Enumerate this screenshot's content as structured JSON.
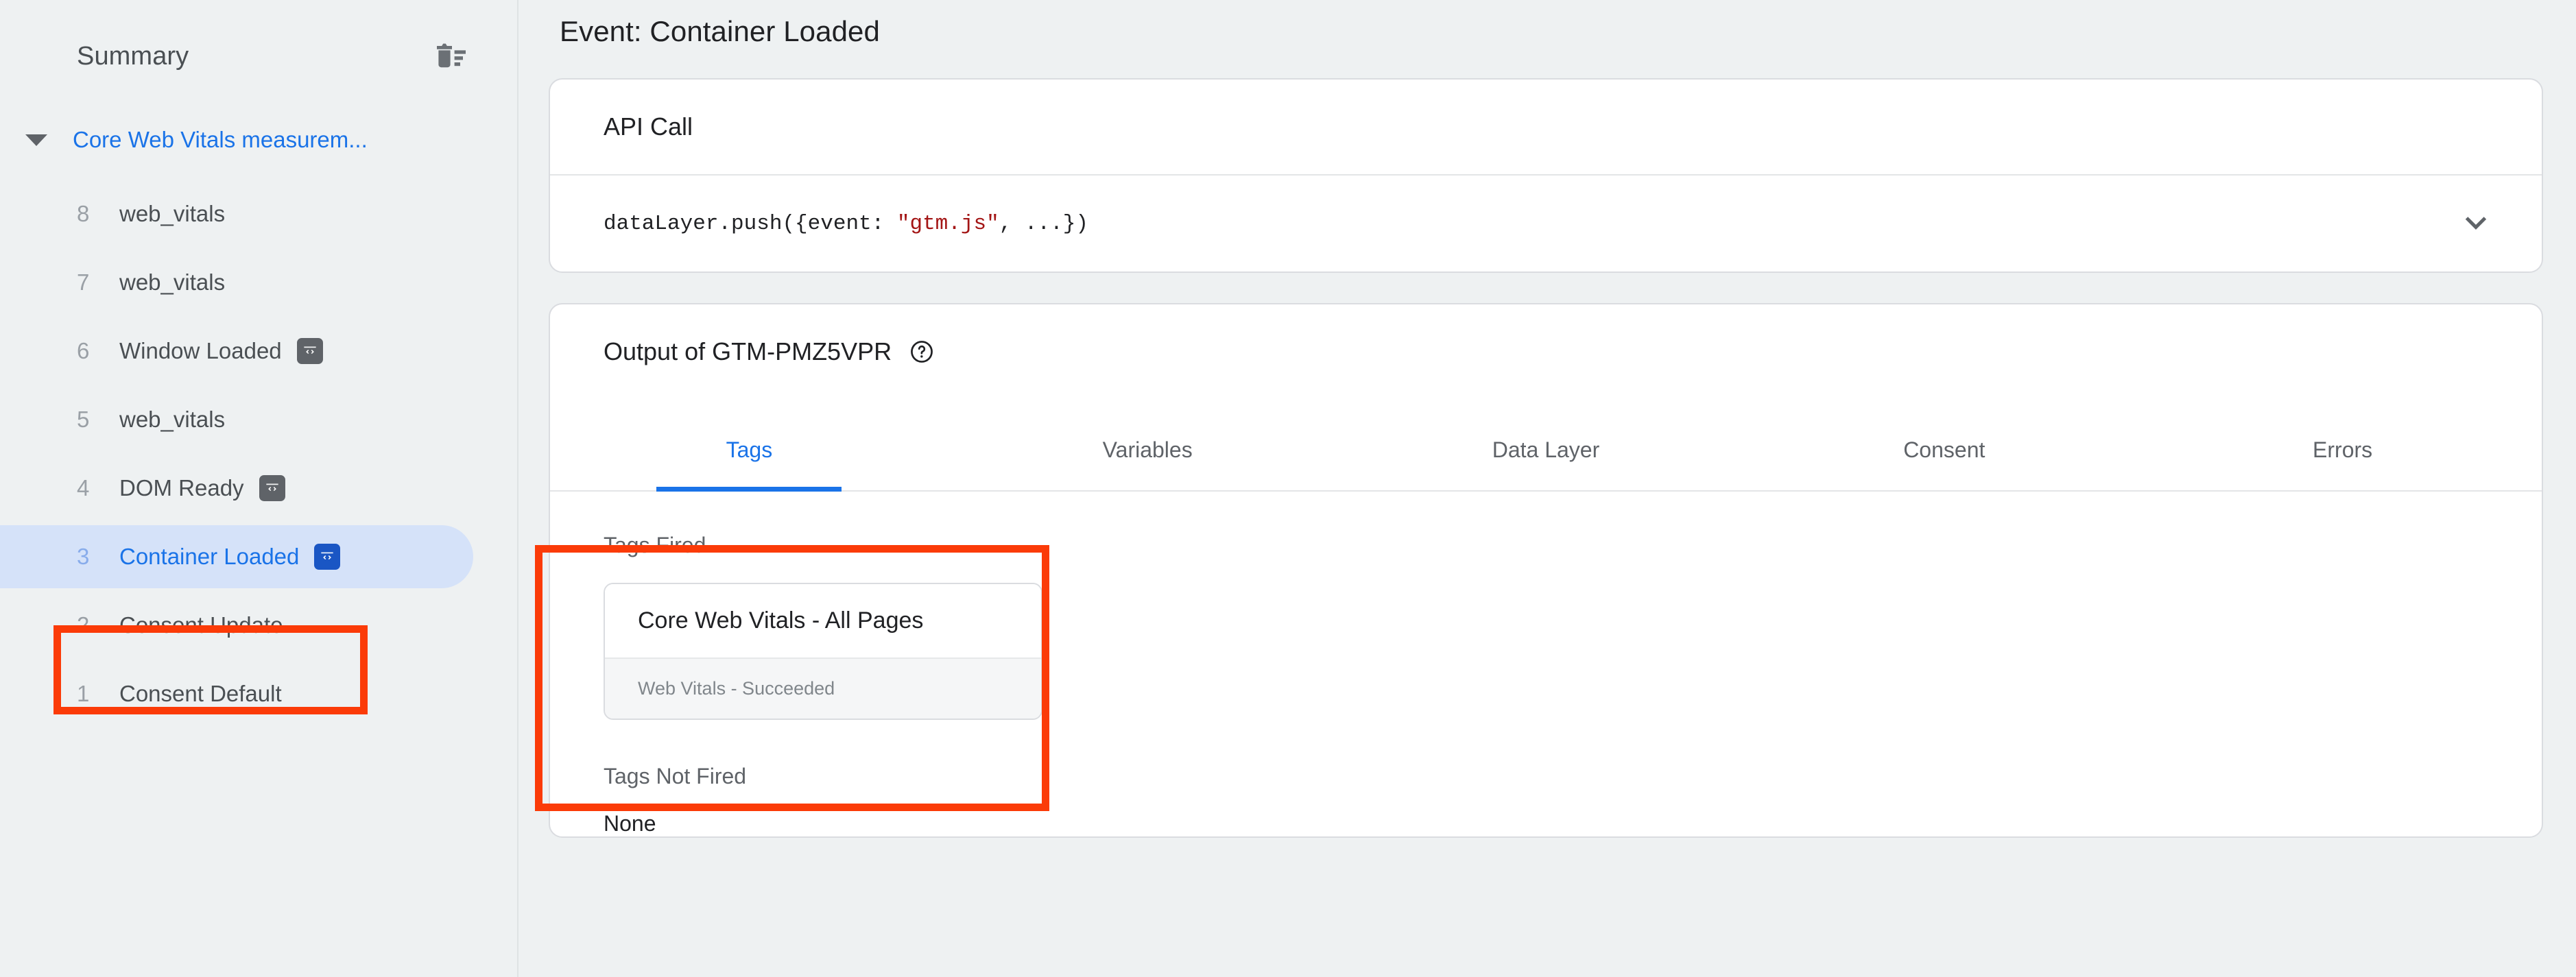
{
  "sidebar": {
    "title": "Summary",
    "clear_icon": "delete-all-icon",
    "group": {
      "label": "Core Web Vitals measurem...",
      "caret_icon": "caret-down-icon",
      "expanded": true
    },
    "events": [
      {
        "num": "8",
        "name": "web_vitals",
        "has_code_badge": false,
        "selected": false
      },
      {
        "num": "7",
        "name": "web_vitals",
        "has_code_badge": false,
        "selected": false
      },
      {
        "num": "6",
        "name": "Window Loaded",
        "has_code_badge": true,
        "selected": false
      },
      {
        "num": "5",
        "name": "web_vitals",
        "has_code_badge": false,
        "selected": false
      },
      {
        "num": "4",
        "name": "DOM Ready",
        "has_code_badge": true,
        "selected": false
      },
      {
        "num": "3",
        "name": "Container Loaded",
        "has_code_badge": true,
        "selected": true
      },
      {
        "num": "2",
        "name": "Consent Update",
        "has_code_badge": false,
        "selected": false
      },
      {
        "num": "1",
        "name": "Consent Default",
        "has_code_badge": false,
        "selected": false
      }
    ]
  },
  "main": {
    "page_title": "Event: Container Loaded",
    "api_call": {
      "header": "API Call",
      "code_prefix": "dataLayer.push({event: ",
      "code_string": "\"gtm.js\"",
      "code_suffix": ", ...})",
      "expand_icon": "chevron-down-icon"
    },
    "output": {
      "header": "Output of GTM-PMZ5VPR",
      "container_id": "GTM-PMZ5VPR",
      "help_icon": "help-circle-icon",
      "tabs": [
        {
          "label": "Tags",
          "active": true
        },
        {
          "label": "Variables",
          "active": false
        },
        {
          "label": "Data Layer",
          "active": false
        },
        {
          "label": "Consent",
          "active": false
        },
        {
          "label": "Errors",
          "active": false
        }
      ],
      "tags_fired_label": "Tags Fired",
      "tags_fired": [
        {
          "name": "Core Web Vitals - All Pages",
          "status": "Web Vitals - Succeeded"
        }
      ],
      "tags_not_fired_label": "Tags Not Fired",
      "tags_not_fired_value": "None"
    }
  },
  "colors": {
    "accent_blue": "#1a73e8",
    "selected_pill": "#d5e2f9",
    "annotation_red": "#fb3b08",
    "code_string_red": "#a31515",
    "page_bg": "#eef1f2",
    "card_bg": "#ffffff"
  }
}
